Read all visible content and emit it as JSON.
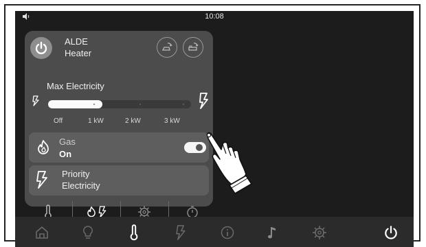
{
  "status_bar": {
    "time": "10:08",
    "speaker_icon": "speaker-icon"
  },
  "heater": {
    "name_line1": "ALDE",
    "name_line2": "Heater",
    "power_icon": "power-icon",
    "mode_buttons": [
      "comfort-mode-icon",
      "bed-mode-icon"
    ]
  },
  "max_electricity": {
    "label": "Max Electricity",
    "levels": [
      "Off",
      "1 kW",
      "2 kW",
      "3 kW"
    ],
    "selected_fraction": 0.38
  },
  "gas": {
    "label": "Gas",
    "state": "On",
    "toggle_on": true
  },
  "priority": {
    "line1": "Priority",
    "line2": "Electricity"
  },
  "panel_tabs": [
    "thermometer-icon",
    "gas-electric-icon",
    "settings-icon",
    "timer-icon"
  ],
  "nav": [
    "home-icon",
    "bulb-icon",
    "thermometer-icon",
    "bolt-icon",
    "info-icon",
    "music-icon",
    "settings-icon",
    "power-icon"
  ],
  "colors": {
    "screen": "#1c1c1c",
    "panel": "#4c4c4c",
    "row": "#5e5e5e",
    "nav": "#2b2b2b"
  }
}
